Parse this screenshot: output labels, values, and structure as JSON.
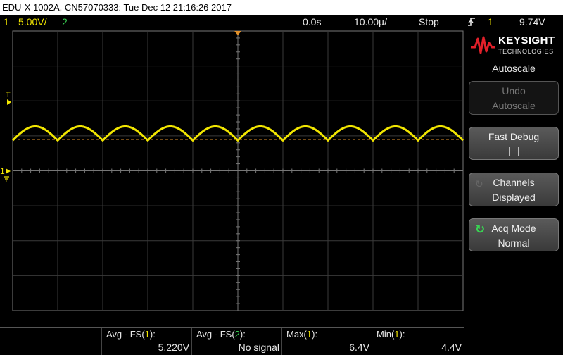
{
  "title_bar": {
    "text": "EDU-X 1002A, CN57070333: Tue Dec 12 21:16:26 2017"
  },
  "status_bar": {
    "ch1_num": "1",
    "ch1_scale": "5.00V/",
    "ch2_num": "2",
    "time_delay": "0.0s",
    "time_scale": "10.00µ/",
    "run_state": "Stop",
    "trigger_slope_icon": "rising-edge-icon",
    "trigger_channel": "1",
    "trigger_level": "9.74V"
  },
  "display": {
    "trigger_marker": "T",
    "channel1_marker": "1",
    "trace_color": "#f2e600",
    "background": "#000000",
    "grid_color": "#3a3a3a",
    "trigger_line_color": "#e0902a"
  },
  "chart_data": {
    "type": "line",
    "series": [
      {
        "color": "#f2e600",
        "x": [
          -50,
          -45,
          -40,
          -35,
          -30,
          -25,
          -20,
          -15,
          -10,
          -5,
          0,
          5,
          10,
          15,
          20,
          25,
          30,
          35,
          40,
          45,
          50
        ],
        "y": [
          4.4,
          6.4,
          4.4,
          6.4,
          4.4,
          6.4,
          4.4,
          6.4,
          4.4,
          6.4,
          4.4,
          6.4,
          4.4,
          6.4,
          4.4,
          6.4,
          4.4,
          6.4,
          4.4,
          6.4,
          4.4
        ]
      }
    ],
    "grid": true,
    "x_divisions": 10,
    "y_divisions": 8
  },
  "side_panel": {
    "brand": "KEYSIGHT",
    "brand_sub": "TECHNOLOGIES",
    "section": "Autoscale",
    "undo_line1": "Undo",
    "undo_line2": "Autoscale",
    "fast_debug": "Fast Debug",
    "channels_line1": "Channels",
    "channels_line2": "Displayed",
    "acq_line1": "Acq Mode",
    "acq_line2": "Normal"
  },
  "measurements": [
    {
      "label_prefix": "Avg - FS(",
      "ch": "1",
      "label_suffix": "):",
      "value": "5.220V"
    },
    {
      "label_prefix": "Avg - FS(",
      "ch": "2",
      "label_suffix": "):",
      "value": "No signal"
    },
    {
      "label_prefix": "Max(",
      "ch": "1",
      "label_suffix": "):",
      "value": "6.4V"
    },
    {
      "label_prefix": "Min(",
      "ch": "1",
      "label_suffix": "):",
      "value": "4.4V"
    }
  ]
}
